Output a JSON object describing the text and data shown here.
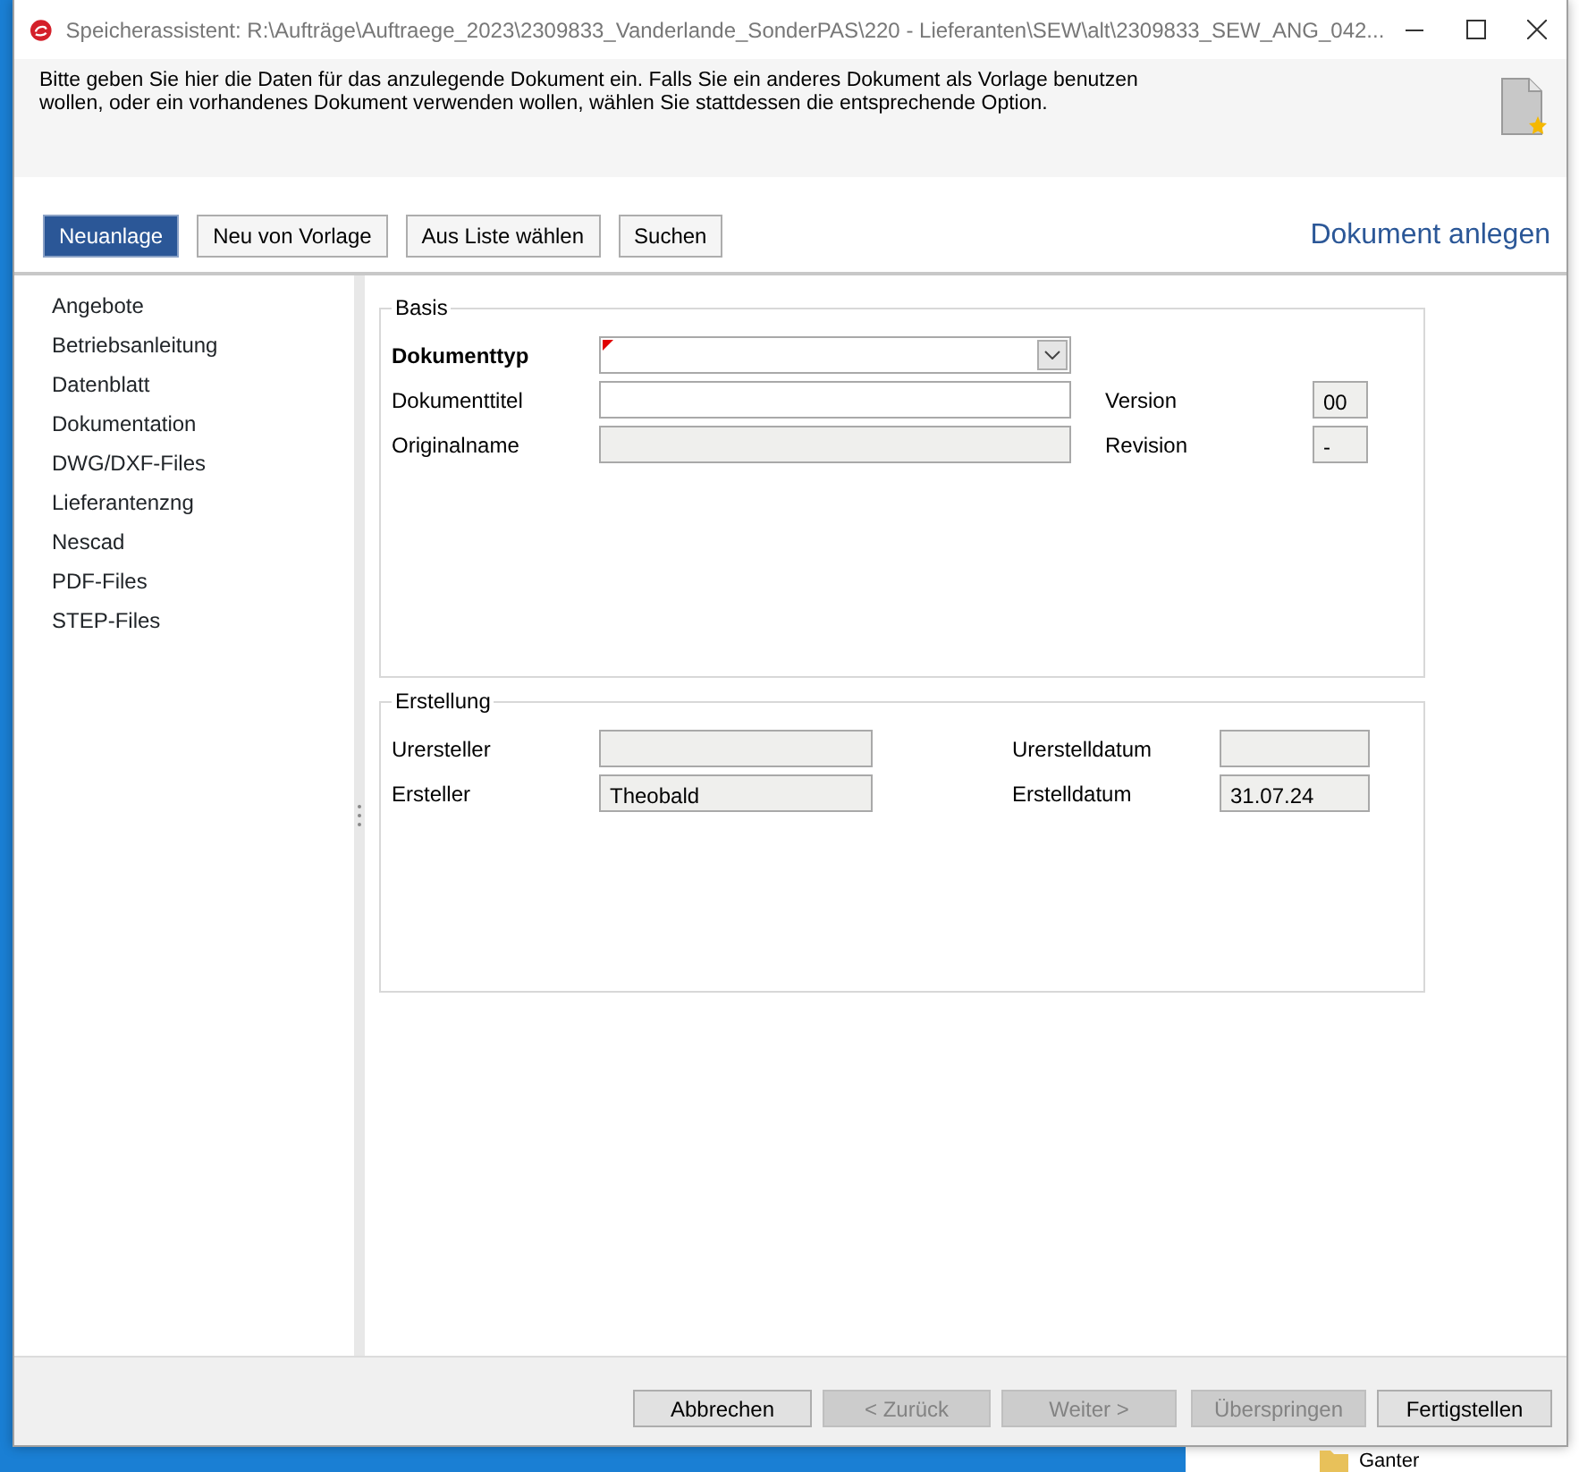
{
  "window": {
    "title": "Speicherassistent: R:\\Aufträge\\Auftraege_2023\\2309833_Vanderlande_SonderPAS\\220 - Lieferanten\\SEW\\alt\\2309833_SEW_ANG_042..."
  },
  "intro": "Bitte geben Sie hier die Daten für das anzulegende Dokument ein. Falls Sie ein anderes Dokument als Vorlage benutzen wollen, oder ein vorhandenes Dokument verwenden wollen, wählen Sie stattdessen die entsprechende Option.",
  "modes": [
    {
      "label": "Neuanlage",
      "selected": true
    },
    {
      "label": "Neu von Vorlage",
      "selected": false
    },
    {
      "label": "Aus Liste wählen",
      "selected": false
    },
    {
      "label": "Suchen",
      "selected": false
    }
  ],
  "heading": "Dokument anlegen",
  "categories": [
    "Angebote",
    "Betriebsanleitung",
    "Datenblatt",
    "Dokumentation",
    "DWG/DXF-Files",
    "Lieferantenzng",
    "Nescad",
    "PDF-Files",
    "STEP-Files"
  ],
  "groups": [
    {
      "title": "Basis",
      "rows": [
        [
          {
            "label": "Dokumenttyp",
            "kind": "combo",
            "bold": true,
            "required": true,
            "disabled": false
          }
        ],
        [
          {
            "label": "Dokumenttitel",
            "kind": "text",
            "disabled": false
          },
          {
            "label": "Version",
            "kind": "text",
            "value": "00",
            "disabled": true
          }
        ],
        [
          {
            "label": "Originalname",
            "kind": "text",
            "disabled": true
          },
          {
            "label": "Revision",
            "kind": "text",
            "value": "-",
            "disabled": true
          }
        ]
      ]
    },
    {
      "title": "Erstellung",
      "rows": [
        [
          {
            "label": "Urersteller",
            "kind": "text",
            "disabled": true
          },
          {
            "label": "Urerstelldatum",
            "kind": "text",
            "disabled": true
          }
        ],
        [
          {
            "label": "Ersteller",
            "kind": "text",
            "value": "Theobald",
            "disabled": true
          },
          {
            "label": "Erstelldatum",
            "kind": "text",
            "value": "31.07.24",
            "disabled": true
          }
        ]
      ]
    }
  ],
  "footer_buttons": [
    {
      "label": "Abbrechen",
      "disabled": false
    },
    {
      "label": "< Zurück",
      "disabled": true
    },
    {
      "label": "Weiter >",
      "disabled": true
    },
    {
      "label": "Überspringen",
      "disabled": true
    },
    {
      "label": "Fertigstellen",
      "disabled": false
    }
  ],
  "background_window": {
    "item": "Ganter"
  }
}
